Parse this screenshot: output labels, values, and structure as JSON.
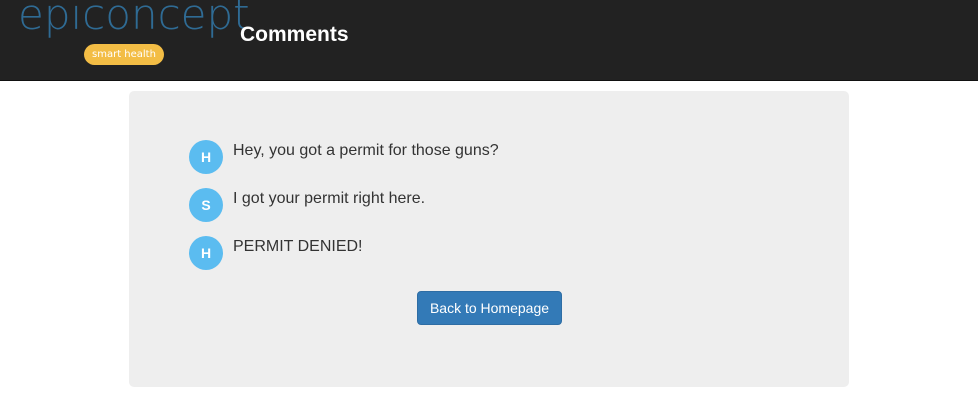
{
  "header": {
    "brand_name": "epiconcept",
    "brand_tagline": "smart health",
    "title": "Comments"
  },
  "comments": [
    {
      "initial": "H",
      "text": "Hey, you got a permit for those guns?"
    },
    {
      "initial": "S",
      "text": "I got your permit right here."
    },
    {
      "initial": "H",
      "text": "PERMIT DENIED!"
    }
  ],
  "actions": {
    "back_label": "Back to Homepage"
  },
  "colors": {
    "navbar_bg": "#222222",
    "brand_blue": "#2f6b94",
    "tagline_bg": "#f3bd45",
    "panel_bg": "#eeeeee",
    "avatar_bg": "#5bbcf0",
    "button_bg": "#337ab7"
  }
}
